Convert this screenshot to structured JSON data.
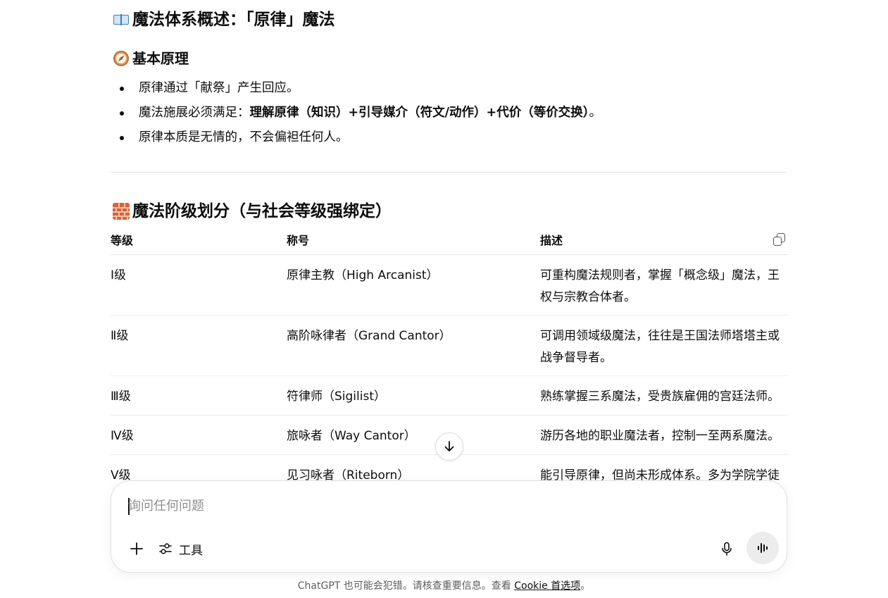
{
  "section1": {
    "title": "魔法体系概述：「原律」魔法",
    "icon": "open-book-icon"
  },
  "principles": {
    "title": "基本原理",
    "icon": "compass-icon",
    "bullets": [
      {
        "text": "原律通过「献祭」产生回应。"
      },
      {
        "prefix": "魔法施展必须满足：",
        "bold": "理解原律（知识）+引导媒介（符文/动作）+代价（等价交换）",
        "suffix": "。"
      },
      {
        "text": "原律本质是无情的，不会偏袒任何人。"
      }
    ]
  },
  "section2": {
    "title": "魔法阶级划分（与社会等级强绑定）",
    "icon": "brick-icon"
  },
  "table": {
    "headers": [
      "等级",
      "称号",
      "描述"
    ],
    "copy_icon": "copy-icon",
    "rows": [
      {
        "level": "Ⅰ级",
        "title": "原律主教（High Arcanist）",
        "desc": "可重构魔法规则者，掌握「概念级」魔法，王权与宗教合体者。"
      },
      {
        "level": "Ⅱ级",
        "title": "高阶咏律者（Grand Cantor）",
        "desc": "可调用领域级魔法，往往是王国法师塔塔主或战争督导者。"
      },
      {
        "level": "Ⅲ级",
        "title": "符律师（Sigilist）",
        "desc": "熟练掌握三系魔法，受贵族雇佣的宫廷法师。"
      },
      {
        "level": "Ⅳ级",
        "title": "旅咏者（Way Cantor）",
        "desc": "游历各地的职业魔法者，控制一至两系魔法。"
      },
      {
        "level": "Ⅴ级",
        "title": "见习咏者（Riteborn）",
        "desc": "能引导原律，但尚未形成体系。多为学院学徒"
      }
    ]
  },
  "composer": {
    "placeholder": "询问任何问题",
    "value": "",
    "tools_label": "工具",
    "plus_icon": "plus-icon",
    "tools_icon": "sliders-icon",
    "mic_icon": "microphone-icon",
    "voice_icon": "voice-waveform-icon"
  },
  "footer": {
    "text": "ChatGPT 也可能会犯错。请核查重要信息。查看 ",
    "link": "Cookie 首选项",
    "suffix": "。"
  },
  "scroll_button_icon": "arrow-down-icon"
}
